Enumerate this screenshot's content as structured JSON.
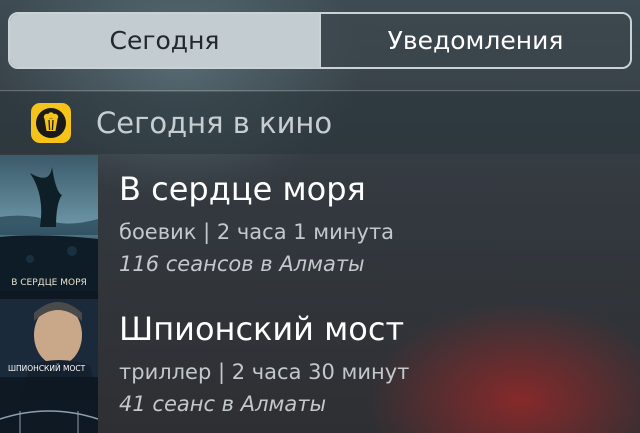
{
  "tabs": {
    "today_label": "Сегодня",
    "notifications_label": "Уведомления"
  },
  "widget": {
    "icon": "popcorn-icon",
    "title": "Сегодня в кино",
    "accent": "#f6c31b"
  },
  "movies": [
    {
      "title": "В сердце моря",
      "meta": "боевик | 2 часа 1 минута",
      "sessions": "116 сеансов в Алматы",
      "poster_text": "В СЕРДЦЕ МОРЯ"
    },
    {
      "title": "Шпионский мост",
      "meta": "триллер | 2 часа 30 минут",
      "sessions": "41 сеанс в Алматы",
      "poster_text": "ШПИОНСКИЙ МОСТ"
    }
  ]
}
